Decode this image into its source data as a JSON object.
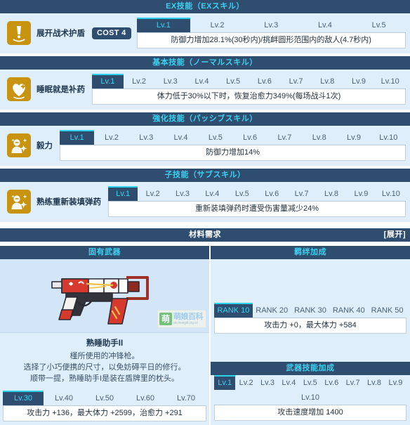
{
  "sections": {
    "ex": {
      "title": "EX技能（EXスキル）"
    },
    "normal": {
      "title": "基本技能（ノーマルスキル）"
    },
    "passive": {
      "title": "強化技能（パッシブスキル）"
    },
    "sub": {
      "title": "子技能（サブスキル）"
    },
    "materials": {
      "title": "材料需求",
      "action": "[展开]"
    },
    "weapon": {
      "title": "固有武器"
    },
    "bond": {
      "title": "羁绊加成"
    },
    "weapon_skill": {
      "title": "武器技能加成"
    }
  },
  "ex_skill": {
    "icon": "alert-exclamation-icon",
    "name": "展开战术护盾",
    "cost": "COST 4",
    "levels": [
      "Lv.1",
      "Lv.2",
      "Lv.3",
      "Lv.4",
      "Lv.5"
    ],
    "active_level": 0,
    "description": "防御力增加28.1%(30秒内)/挑衅圆形范围内的敌人(4.7秒内)"
  },
  "normal_skill": {
    "icon": "heart-plus-icon",
    "name": "睡眠就是补药",
    "levels": [
      "Lv.1",
      "Lv.2",
      "Lv.3",
      "Lv.4",
      "Lv.5",
      "Lv.6",
      "Lv.7",
      "Lv.8",
      "Lv.9",
      "Lv.10"
    ],
    "active_level": 0,
    "description": "体力低于30%以下时，恢复治愈力349%(每场战斗1次)"
  },
  "passive_skill": {
    "icon": "person-sparkle-icon",
    "name": "毅力",
    "levels": [
      "Lv.1",
      "Lv.2",
      "Lv.3",
      "Lv.4",
      "Lv.5",
      "Lv.6",
      "Lv.7",
      "Lv.8",
      "Lv.9",
      "Lv.10"
    ],
    "active_level": 0,
    "description": "防御力增加14%"
  },
  "sub_skill": {
    "icon": "person-sparkle-icon",
    "name": "熟练重新装填弹药",
    "levels": [
      "Lv.1",
      "Lv.2",
      "Lv.3",
      "Lv.4",
      "Lv.5",
      "Lv.6",
      "Lv.7",
      "Lv.8",
      "Lv.9",
      "Lv.10"
    ],
    "active_level": 0,
    "description": "重新装填弹药时遭受伤害量减少24%"
  },
  "weapon": {
    "image_name": "smg-weapon-red-white",
    "name": "熟睡助手II",
    "description_lines": [
      "槿所使用的冲锋枪。",
      "选择了小巧便携的尺寸，以免妨碍平日的修行。",
      "顺带一提，熟睡助手I是装在盾牌里的枕头。"
    ],
    "levels": [
      "Lv.30",
      "Lv.40",
      "Lv.50",
      "Lv.60",
      "Lv.70"
    ],
    "active_level": 0,
    "stats": "攻击力 +136，最大体力 +2599，治愈力 +291"
  },
  "bond": {
    "ranks": [
      "RANK 10",
      "RANK 20",
      "RANK 30",
      "RANK 40",
      "RANK 50"
    ],
    "active_rank": 0,
    "stats": "攻击力 +0，最大体力 +584"
  },
  "weapon_skill": {
    "levels": [
      "Lv.1",
      "Lv.2",
      "Lv.3",
      "Lv.4",
      "Lv.5",
      "Lv.6",
      "Lv.7",
      "Lv.8",
      "Lv.9",
      "Lv.10"
    ],
    "active_level": 0,
    "description": "攻击速度增加 1400"
  },
  "watermark": {
    "kanji": "萌",
    "big": "萌娘百科",
    "small": "ak.moegirl.org.cn"
  },
  "colors": {
    "header_bar": "#2f4e6f",
    "header_text": "#3fd0f0",
    "panel_bg": "#dfeefb",
    "active_tab_bg": "#2f4e6f",
    "active_tab_border": "#2ad2ec",
    "icon_gold": "#c8930f"
  }
}
